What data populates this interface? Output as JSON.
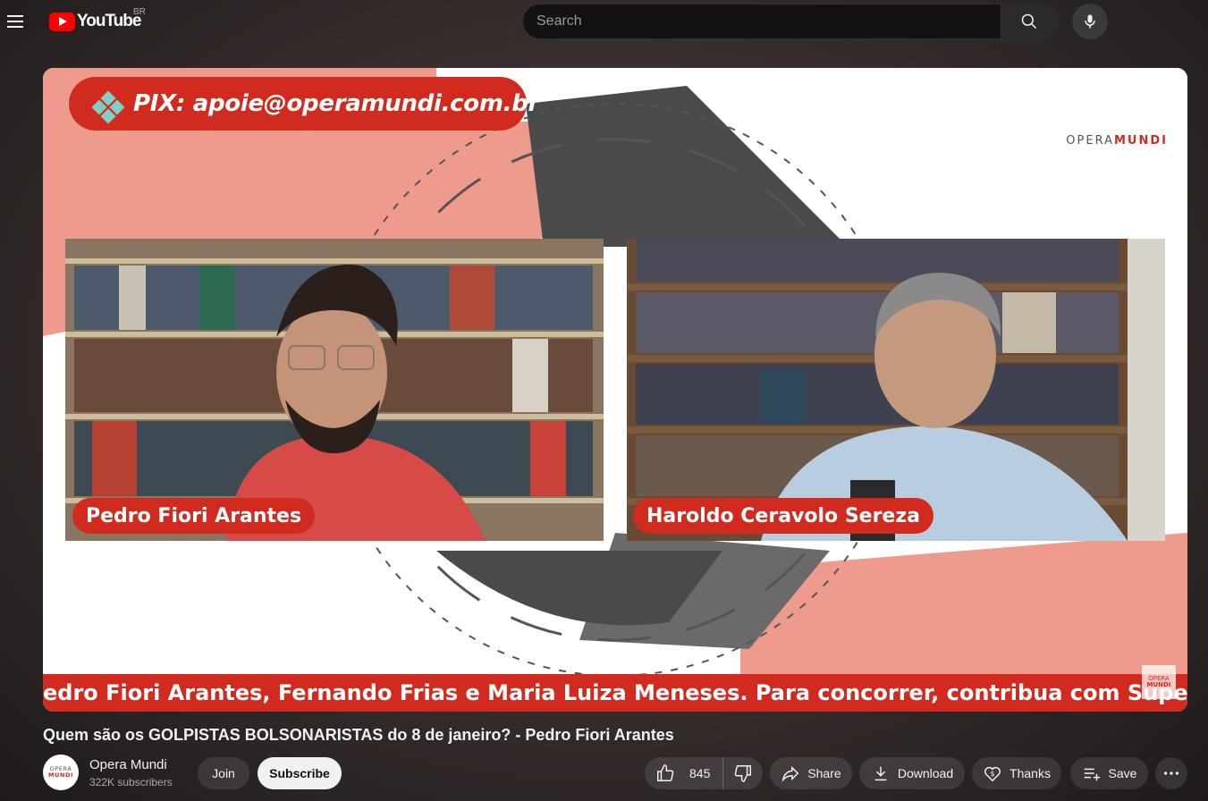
{
  "header": {
    "logo_text": "YouTube",
    "region": "BR",
    "search_placeholder": "Search"
  },
  "video": {
    "pix_banner": "PIX: apoie@operamundi.com.br",
    "brand_prefix": "OPERA",
    "brand_suffix": "MUNDI",
    "speaker_left": "Pedro Fiori Arantes",
    "speaker_right": "Haroldo Ceravolo Sereza",
    "ticker": "edro Fiori Arantes, Fernando Frias e Maria Luiza Meneses. Para concorrer, contribua com SuperChat e/ou S",
    "mini_logo_top": "OPERA",
    "mini_logo_bottom": "MUNDI",
    "colors": {
      "accent_red": "#d12a1f",
      "salmon": "#ee9a8c",
      "dark_gray": "#4a4a4a"
    }
  },
  "title": "Quem são os GOLPISTAS BOLSONARISTAS do 8 de janeiro? - Pedro Fiori Arantes",
  "channel": {
    "name": "Opera Mundi",
    "subscribers": "322K subscribers",
    "avatar_top": "OPERA",
    "avatar_bottom": "MUNDI"
  },
  "actions": {
    "join": "Join",
    "subscribe": "Subscribe",
    "like_count": "845",
    "share": "Share",
    "download": "Download",
    "thanks": "Thanks",
    "save": "Save"
  },
  "icons": [
    "menu-icon",
    "search-icon",
    "mic-icon",
    "like-icon",
    "dislike-icon",
    "share-icon",
    "download-icon",
    "thanks-icon",
    "save-icon",
    "more-icon",
    "pix-icon"
  ]
}
